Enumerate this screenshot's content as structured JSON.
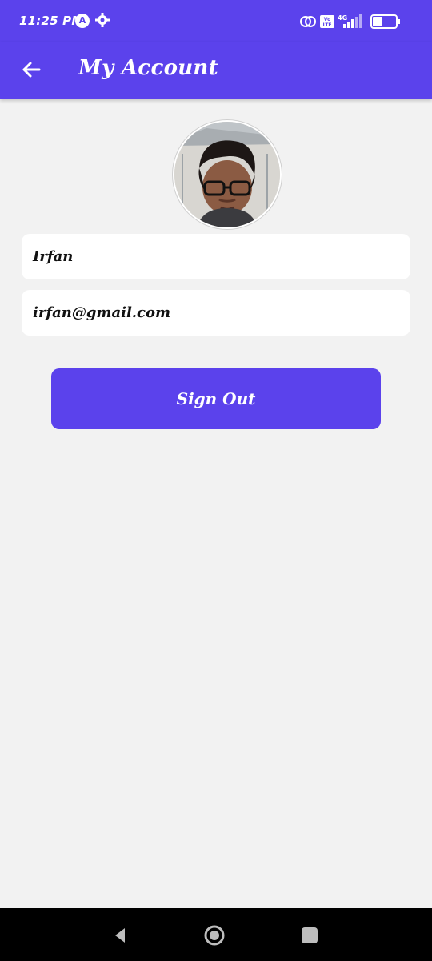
{
  "status_bar": {
    "time": "11:25 PM",
    "network_label": "4G+",
    "volte_label": "Vo LTE",
    "battery_level": "41",
    "colors": {
      "background": "#5b42ec",
      "foreground": "#ffffff"
    },
    "icons": [
      "app-a-icon",
      "gear-icon",
      "sync-icon",
      "volte-icon",
      "signal-icon",
      "battery-icon"
    ]
  },
  "app_bar": {
    "title": "My Account",
    "back_icon": "arrow-left-icon",
    "color": "#5b42ec"
  },
  "profile": {
    "name": "Irfan",
    "email": "irfan@gmail.com"
  },
  "actions": {
    "sign_out_label": "Sign Out",
    "button_color": "#5b42ec"
  },
  "navigation_bar": {
    "icons": [
      "nav-back-icon",
      "nav-home-icon",
      "nav-recents-icon"
    ]
  }
}
